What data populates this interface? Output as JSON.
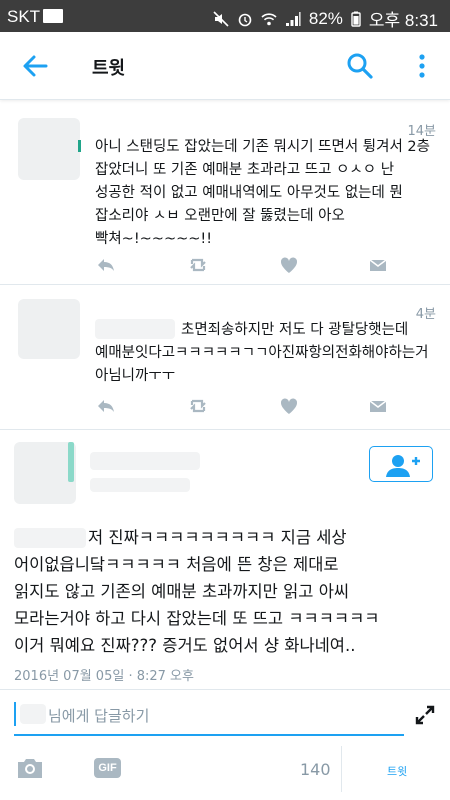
{
  "status_bar": {
    "carrier": "SKT",
    "battery": "82%",
    "time": "오후 8:31"
  },
  "app_bar": {
    "title": "트윗"
  },
  "replies": [
    {
      "time": "14분",
      "text": "아니 스탠딩도 잡았는데 기존 뭐시기 뜨면서 튕겨서 2층\n잡았더니 또 기존 예매분 초과라고 뜨고 ㅇㅅㅇ 난\n성공한 적이 없고 예매내역에도 아무것도 없는데 뭔\n잡소리야 ㅅㅂ 오랜만에 잘 뚫렸는데 아오\n빡쳐~!~~~~~!!"
    },
    {
      "time": "4분",
      "text": "초면죄송하지만 저도 다 광탈당햇는데\n예매분잇다고ㅋㅋㅋㅋㅋㄱㄱ아진짜항의전화해야하는거\n아님니까ㅜㅜ"
    }
  ],
  "main_tweet": {
    "text": "저 진짜ㅋㅋㅋㅋㅋㅋㅋㅋㅋ 지금 세상\n어이없읍니닼ㅋㅋㅋㅋㅋ 처음에 뜬 창은 제대로\n읽지도 않고 기존의 예매분 초과까지만 읽고 아씨\n모라는거야 하고 다시 잡았는데 또 뜨고 ㅋㅋㅋㅋㅋㅋ\n이거 뭐예요 진짜??? 증거도 없어서 샹 화나네여..",
    "date": "2016년 07월 05일 · 8:27 오후"
  },
  "reply_bar": {
    "placeholder": "님에게 답글하기",
    "gif_label": "GIF",
    "char_count": "140",
    "tweet_button": "트윗"
  },
  "colors": {
    "accent": "#1da1f2",
    "icon_gray": "#aab8c2",
    "status_bar": "#3d3d3d"
  }
}
